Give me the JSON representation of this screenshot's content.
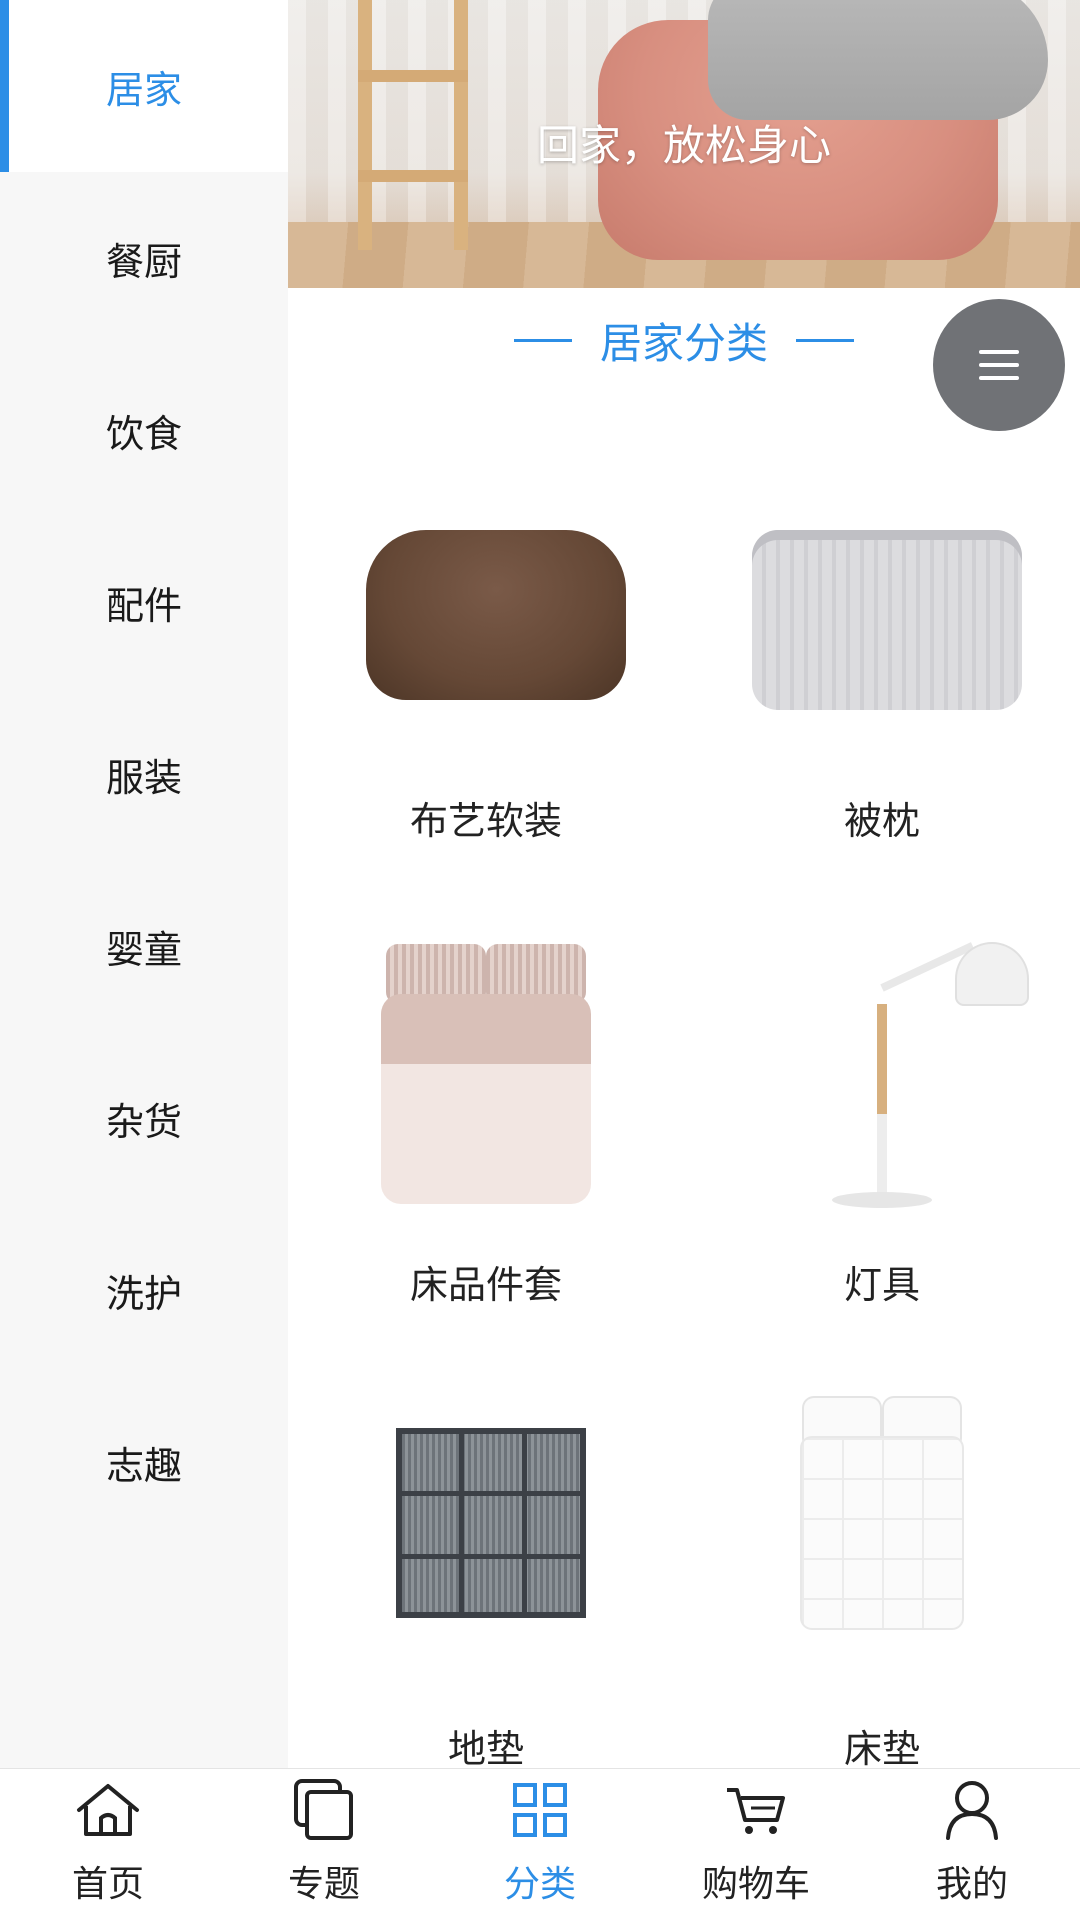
{
  "sidebar": {
    "items": [
      {
        "label": "居家"
      },
      {
        "label": "餐厨"
      },
      {
        "label": "饮食"
      },
      {
        "label": "配件"
      },
      {
        "label": "服装"
      },
      {
        "label": "婴童"
      },
      {
        "label": "杂货"
      },
      {
        "label": "洗护"
      },
      {
        "label": "志趣"
      }
    ],
    "active_index": 0
  },
  "banner": {
    "slogan": "回家，放松身心"
  },
  "section": {
    "title": "居家分类"
  },
  "categories": [
    {
      "label": "布艺软装",
      "icon": "pouf-image"
    },
    {
      "label": "被枕",
      "icon": "quilt-image"
    },
    {
      "label": "床品件套",
      "icon": "bedding-set-image"
    },
    {
      "label": "灯具",
      "icon": "lamp-image"
    },
    {
      "label": "地垫",
      "icon": "floor-mat-image"
    },
    {
      "label": "床垫",
      "icon": "mattress-image"
    }
  ],
  "fab": {
    "icon": "menu-icon"
  },
  "tabbar": {
    "items": [
      {
        "label": "首页",
        "icon": "home-icon"
      },
      {
        "label": "专题",
        "icon": "topics-icon"
      },
      {
        "label": "分类",
        "icon": "category-icon"
      },
      {
        "label": "购物车",
        "icon": "cart-icon"
      },
      {
        "label": "我的",
        "icon": "user-icon"
      }
    ],
    "active_index": 2
  },
  "colors": {
    "accent": "#2c8ee6",
    "sidebar_bg": "#f7f7f7",
    "fab_bg": "#707276"
  }
}
